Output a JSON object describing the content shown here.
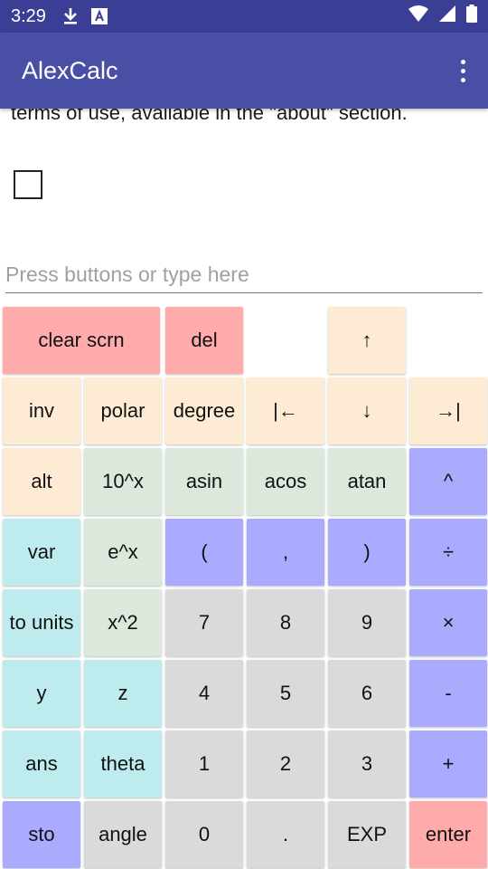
{
  "status_bar": {
    "time": "3:29",
    "icons_left": [
      "download-icon",
      "text-a-icon"
    ],
    "icons_right": [
      "wifi-icon",
      "cellular-icon",
      "battery-icon"
    ]
  },
  "app_bar": {
    "title": "AlexCalc"
  },
  "content": {
    "terms_text": "terms of use, available in the \"about\" section.",
    "input_placeholder": "Press buttons or type here",
    "input_value": ""
  },
  "keypad": {
    "rows": [
      [
        {
          "label": "clear scrn",
          "color": "#ffabab"
        },
        {
          "label": "del",
          "color": "#ffabab"
        },
        {
          "label": "↑",
          "color": "#fdebd3"
        }
      ],
      [
        {
          "label": "inv"
        },
        {
          "label": "polar"
        },
        {
          "label": "degree"
        },
        {
          "label": "|←"
        },
        {
          "label": "↓"
        },
        {
          "label": "→|"
        }
      ],
      [
        {
          "label": "alt"
        },
        {
          "label": "10^x"
        },
        {
          "label": "asin"
        },
        {
          "label": "acos"
        },
        {
          "label": "atan"
        },
        {
          "label": "^"
        }
      ],
      [
        {
          "label": "var"
        },
        {
          "label": "e^x"
        },
        {
          "label": "("
        },
        {
          "label": ","
        },
        {
          "label": ")"
        },
        {
          "label": "÷"
        }
      ],
      [
        {
          "label": "to units"
        },
        {
          "label": "x^2"
        },
        {
          "label": "7"
        },
        {
          "label": "8"
        },
        {
          "label": "9"
        },
        {
          "label": "×"
        }
      ],
      [
        {
          "label": "y"
        },
        {
          "label": "z"
        },
        {
          "label": "4"
        },
        {
          "label": "5"
        },
        {
          "label": "6"
        },
        {
          "label": "-"
        }
      ],
      [
        {
          "label": "ans"
        },
        {
          "label": "theta"
        },
        {
          "label": "1"
        },
        {
          "label": "2"
        },
        {
          "label": "3"
        },
        {
          "label": "+"
        }
      ],
      [
        {
          "label": "sto"
        },
        {
          "label": "angle"
        },
        {
          "label": "0"
        },
        {
          "label": "."
        },
        {
          "label": "EXP"
        },
        {
          "label": "enter"
        }
      ]
    ]
  },
  "colors": {
    "status_bar": "#3a3f95",
    "app_bar": "#4a4fa6",
    "key_red": "#ffabab",
    "key_orange": "#fdebd3",
    "key_green": "#dce8dc",
    "key_blue": "#aaaaff",
    "key_cyan": "#bdebee",
    "key_gray": "#dadada"
  }
}
